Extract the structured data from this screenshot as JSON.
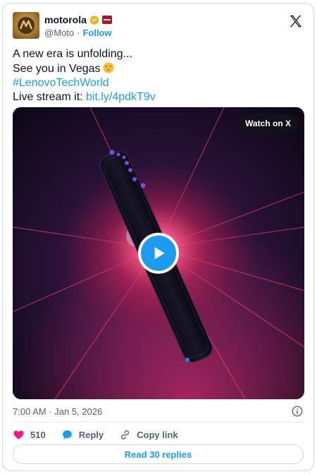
{
  "header": {
    "name": "motorola",
    "handle": "@Moto",
    "separator": "·",
    "follow_label": "Follow"
  },
  "post": {
    "line1": "A new era is unfolding...",
    "line2": "See you in Vegas",
    "hashtag": "#LenovoTechWorld",
    "live_prefix": "Live stream it: ",
    "live_link": "bit.ly/4pdkT9v"
  },
  "media": {
    "watch_label": "Watch on X"
  },
  "footer": {
    "timestamp": "7:00 AM · Jan 5, 2026",
    "likes": "510",
    "reply_label": "Reply",
    "copy_label": "Copy link",
    "read_replies": "Read 30 replies"
  },
  "colors": {
    "accent": "#1d9bf0",
    "like": "#f91880",
    "text": "#0f1419",
    "muted": "#536471"
  }
}
